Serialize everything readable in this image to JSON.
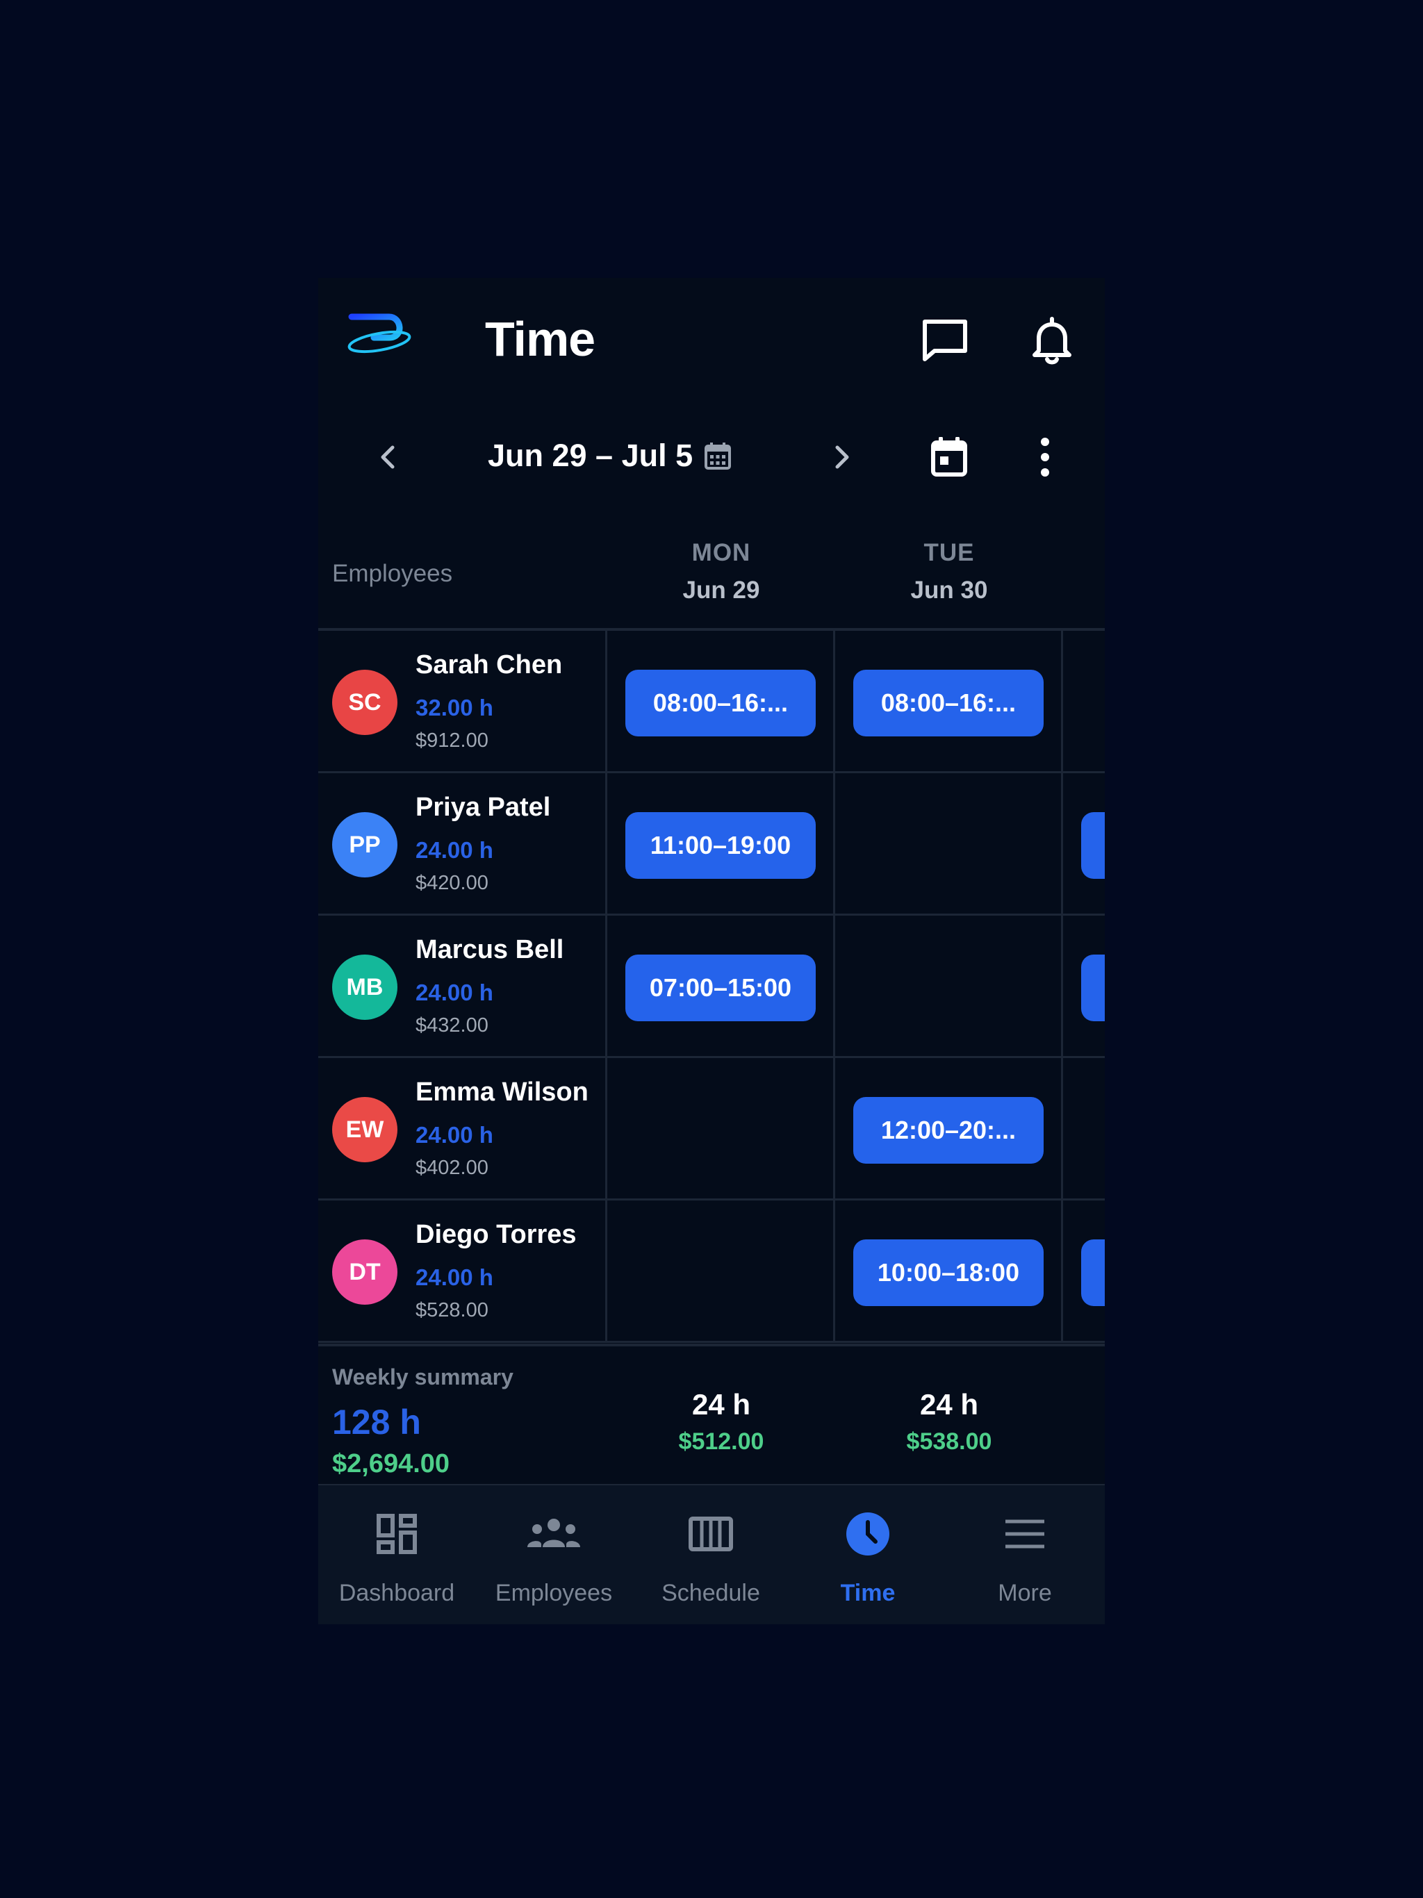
{
  "header": {
    "title": "Time",
    "chat_icon": "chat-icon",
    "bell_icon": "bell-icon"
  },
  "week": {
    "range": "Jun 29 – Jul 5"
  },
  "grid": {
    "employees_label": "Employees",
    "days": [
      {
        "dow": "MON",
        "date": "Jun 29"
      },
      {
        "dow": "TUE",
        "date": "Jun 30"
      }
    ],
    "rows": [
      {
        "initials": "SC",
        "color": "#e84545",
        "name": "Sarah Chen",
        "hours": "32.00 h",
        "pay": "$912.00",
        "mon": "08:00–16:...",
        "tue": "08:00–16:...",
        "wed_peek": false
      },
      {
        "initials": "PP",
        "color": "#3b82f6",
        "name": "Priya Patel",
        "hours": "24.00 h",
        "pay": "$420.00",
        "mon": "11:00–19:00",
        "tue": "",
        "wed_peek": true
      },
      {
        "initials": "MB",
        "color": "#14b89a",
        "name": "Marcus Bell",
        "hours": "24.00 h",
        "pay": "$432.00",
        "mon": "07:00–15:00",
        "tue": "",
        "wed_peek": true
      },
      {
        "initials": "EW",
        "color": "#ea4a47",
        "name": "Emma Wilson",
        "hours": "24.00 h",
        "pay": "$402.00",
        "mon": "",
        "tue": "12:00–20:...",
        "wed_peek": false
      },
      {
        "initials": "DT",
        "color": "#ec4899",
        "name": "Diego Torres",
        "hours": "24.00 h",
        "pay": "$528.00",
        "mon": "",
        "tue": "10:00–18:00",
        "wed_peek": true
      }
    ]
  },
  "summary": {
    "label": "Weekly summary",
    "total_hours": "128 h",
    "total_pay": "$2,694.00",
    "days": [
      {
        "hours": "24 h",
        "pay": "$512.00"
      },
      {
        "hours": "24 h",
        "pay": "$538.00"
      }
    ]
  },
  "tabs": [
    {
      "label": "Dashboard",
      "icon": "dashboard-icon",
      "active": false
    },
    {
      "label": "Employees",
      "icon": "people-icon",
      "active": false
    },
    {
      "label": "Schedule",
      "icon": "schedule-icon",
      "active": false
    },
    {
      "label": "Time",
      "icon": "clock-icon",
      "active": true
    },
    {
      "label": "More",
      "icon": "menu-icon",
      "active": false
    }
  ],
  "colors": {
    "accent": "#2563eb",
    "money": "#4ecf8a",
    "background": "#040c1a"
  }
}
